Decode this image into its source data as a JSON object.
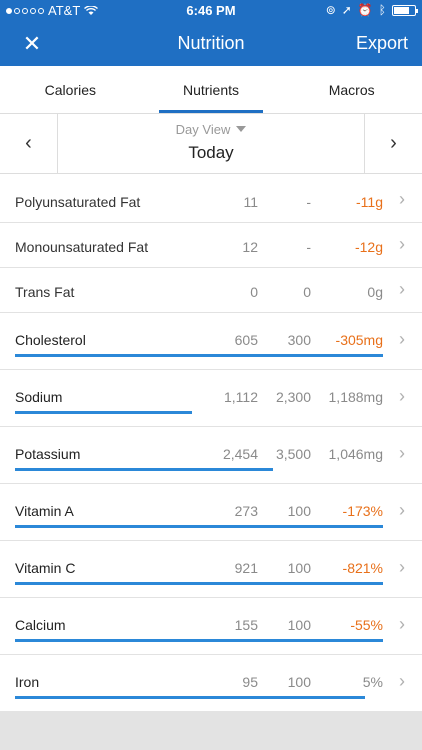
{
  "status": {
    "carrier": "AT&T",
    "time": "6:46 PM"
  },
  "nav": {
    "title": "Nutrition",
    "close": "✕",
    "export": "Export"
  },
  "tabs": [
    "Calories",
    "Nutrients",
    "Macros"
  ],
  "day_view": {
    "mode": "Day View",
    "day": "Today",
    "prev": "‹",
    "next": "›"
  },
  "rows": [
    {
      "name": "Polyunsaturated Fat",
      "total": "11",
      "goal": "-",
      "left": "-11g",
      "neg": true,
      "progress": null
    },
    {
      "name": "Monounsaturated Fat",
      "total": "12",
      "goal": "-",
      "left": "-12g",
      "neg": true,
      "progress": null
    },
    {
      "name": "Trans Fat",
      "total": "0",
      "goal": "0",
      "left": "0g",
      "neg": false,
      "progress": null
    },
    {
      "name": "Cholesterol",
      "total": "605",
      "goal": "300",
      "left": "-305mg",
      "neg": true,
      "progress": 1.0
    },
    {
      "name": "Sodium",
      "total": "1,112",
      "goal": "2,300",
      "left": "1,188mg",
      "neg": false,
      "progress": 0.48
    },
    {
      "name": "Potassium",
      "total": "2,454",
      "goal": "3,500",
      "left": "1,046mg",
      "neg": false,
      "progress": 0.7
    },
    {
      "name": "Vitamin A",
      "total": "273",
      "goal": "100",
      "left": "-173%",
      "neg": true,
      "progress": 1.0
    },
    {
      "name": "Vitamin C",
      "total": "921",
      "goal": "100",
      "left": "-821%",
      "neg": true,
      "progress": 1.0
    },
    {
      "name": "Calcium",
      "total": "155",
      "goal": "100",
      "left": "-55%",
      "neg": true,
      "progress": 1.0
    },
    {
      "name": "Iron",
      "total": "95",
      "goal": "100",
      "left": "5%",
      "neg": false,
      "progress": 0.95
    }
  ],
  "colors": {
    "header": "#1f6fc3",
    "progress": "#2b88d8",
    "negative": "#e8701a"
  }
}
